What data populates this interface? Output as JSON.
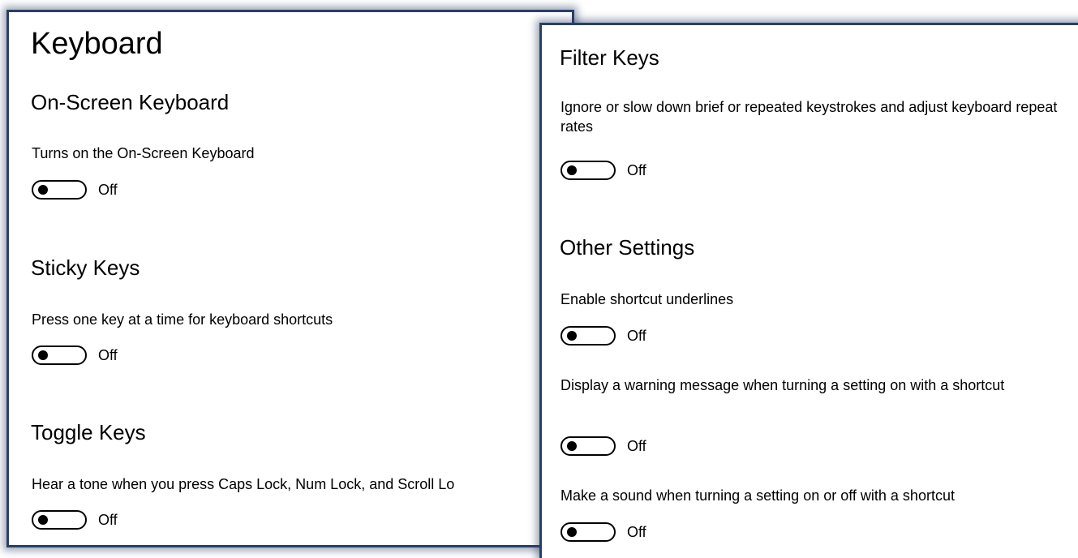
{
  "left_panel": {
    "title": "Keyboard",
    "sections": [
      {
        "heading": "On-Screen Keyboard",
        "description": "Turns on the On-Screen Keyboard",
        "state": "Off"
      },
      {
        "heading": "Sticky Keys",
        "description": "Press one key at a time for keyboard shortcuts",
        "state": "Off"
      },
      {
        "heading": "Toggle Keys",
        "description": "Hear a tone when you press Caps Lock, Num Lock, and Scroll Lo",
        "state": "Off"
      }
    ]
  },
  "right_panel": {
    "filter_keys": {
      "heading": "Filter Keys",
      "description": "Ignore or slow down brief or repeated keystrokes and adjust keyboard repeat rates",
      "state": "Off"
    },
    "other_settings": {
      "heading": "Other Settings",
      "items": [
        {
          "description": "Enable shortcut underlines",
          "state": "Off"
        },
        {
          "description": "Display a warning message when turning a setting on with a shortcut",
          "state": "Off"
        },
        {
          "description": "Make a sound when turning a setting on or off with a shortcut",
          "state": "Off"
        }
      ]
    }
  }
}
